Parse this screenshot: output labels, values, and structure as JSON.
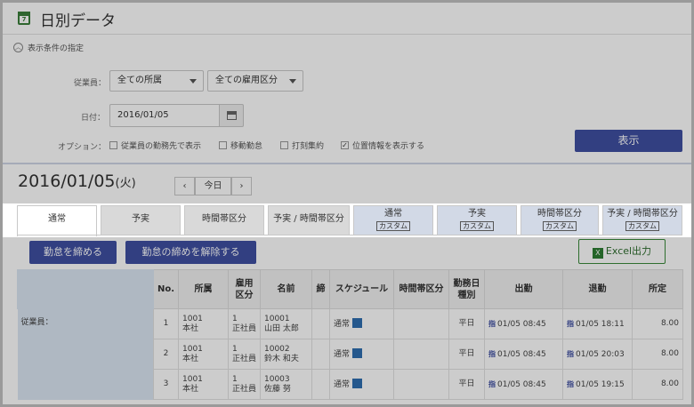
{
  "page": {
    "title": "日別データ",
    "icon": "calendar-icon",
    "icon_text": "7"
  },
  "conditions": {
    "header": "表示条件の指定",
    "employee_label": "従業員：",
    "department_select": "全ての所属",
    "employment_select": "全ての雇用区分",
    "date_label": "日付：",
    "date_value": "2016/01/05",
    "options_label": "オプション：",
    "options": [
      {
        "label": "従業員の勤務先で表示",
        "checked": false
      },
      {
        "label": "移動勤怠",
        "checked": false
      },
      {
        "label": "打刻集約",
        "checked": false
      },
      {
        "label": "位置情報を表示する",
        "checked": true
      }
    ],
    "check_mark": "✓",
    "show_button": "表示"
  },
  "date_header": {
    "date": "2016/01/05",
    "weekday": "(火)",
    "prev": "‹",
    "today": "今日",
    "next": "›"
  },
  "tabs": [
    {
      "label": "通常"
    },
    {
      "label": "予実"
    },
    {
      "label": "時間帯区分"
    },
    {
      "label": "予実 / 時間帯区分"
    },
    {
      "label": "通常",
      "badge": "カスタム"
    },
    {
      "label": "予実",
      "badge": "カスタム"
    },
    {
      "label": "時間帯区分",
      "badge": "カスタム"
    },
    {
      "label": "予実 / 時間帯区分",
      "badge": "カスタム"
    }
  ],
  "actions": {
    "close_button": "勤怠を締める",
    "unclose_button": "勤怠の締めを解除する",
    "excel_button": "Excel出力",
    "excel_icon_text": "X"
  },
  "table": {
    "headers": {
      "no": "No.",
      "dept": "所属",
      "emp_type": [
        "雇用",
        "区分"
      ],
      "name": "名前",
      "close": "締",
      "schedule": "スケジュール",
      "time_zone": "時間帯区分",
      "work_day": [
        "勤務日",
        "種別"
      ],
      "clock_in": "出勤",
      "clock_out": "退勤",
      "scheduled": "所定"
    },
    "employee_label": "従業員：",
    "stamp_mark": "指",
    "rows": [
      {
        "no": "1",
        "dept_code": "1001",
        "dept_name": "本社",
        "type_code": "1",
        "type_name": "正社員",
        "emp_code": "10001",
        "emp_name": "山田 太郎",
        "schedule": "通常",
        "work_day": "平日",
        "clock_in": "01/05 08:45",
        "clock_out": "01/05 18:11",
        "scheduled": "8.00"
      },
      {
        "no": "2",
        "dept_code": "1001",
        "dept_name": "本社",
        "type_code": "1",
        "type_name": "正社員",
        "emp_code": "10002",
        "emp_name": "鈴木 和夫",
        "schedule": "通常",
        "work_day": "平日",
        "clock_in": "01/05 08:45",
        "clock_out": "01/05 20:03",
        "scheduled": "8.00"
      },
      {
        "no": "3",
        "dept_code": "1001",
        "dept_name": "本社",
        "type_code": "1",
        "type_name": "正社員",
        "emp_code": "10003",
        "emp_name": "佐藤 努",
        "schedule": "通常",
        "work_day": "平日",
        "clock_in": "01/05 08:45",
        "clock_out": "01/05 19:15",
        "scheduled": "8.00"
      }
    ]
  }
}
